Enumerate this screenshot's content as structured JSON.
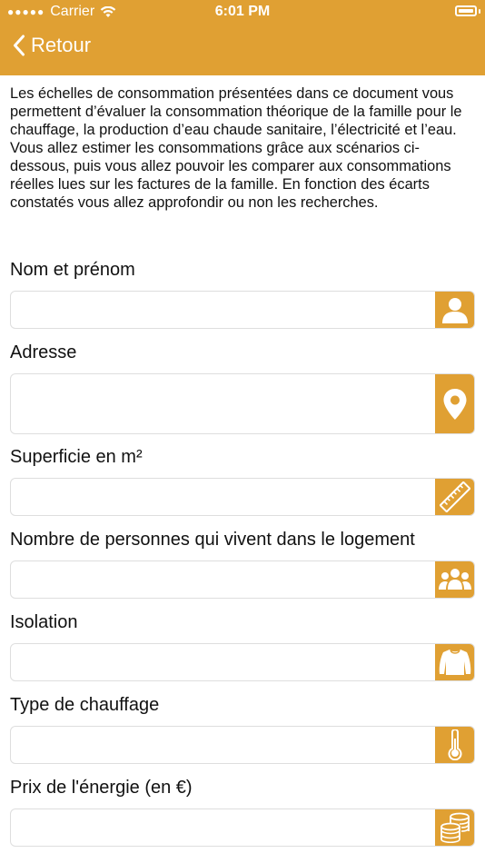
{
  "status_bar": {
    "carrier": "Carrier",
    "time": "6:01 PM"
  },
  "nav": {
    "back_label": "Retour"
  },
  "intro": {
    "paragraph1": "Les échelles de consommation présentées dans ce document vous permettent d’évaluer la consommation théorique de la famille pour le chauffage, la production d’eau chaude sanitaire, l’électricité et l’eau.",
    "paragraph2": "Vous allez estimer les consommations grâce aux scénarios ci-dessous, puis vous allez pouvoir les comparer aux consommations réelles lues sur les factures de la famille. En fonction des écarts constatés vous allez approfondir ou non les recherches."
  },
  "form": {
    "fields": [
      {
        "label": "Nom et prénom",
        "value": "",
        "icon": "person-icon"
      },
      {
        "label": "Adresse",
        "value": "",
        "icon": "location-pin-icon"
      },
      {
        "label": "Superficie en m²",
        "value": "",
        "icon": "ruler-icon"
      },
      {
        "label": "Nombre de personnes qui vivent dans le logement",
        "value": "",
        "icon": "group-icon"
      },
      {
        "label": "Isolation",
        "value": "",
        "icon": "sweater-icon"
      },
      {
        "label": "Type de chauffage",
        "value": "",
        "icon": "thermometer-icon"
      },
      {
        "label": "Prix de l'énergie (en €)",
        "value": "",
        "icon": "coins-icon"
      }
    ]
  },
  "colors": {
    "accent": "#E0A033",
    "text": "#111111",
    "field_border": "#dedede"
  }
}
